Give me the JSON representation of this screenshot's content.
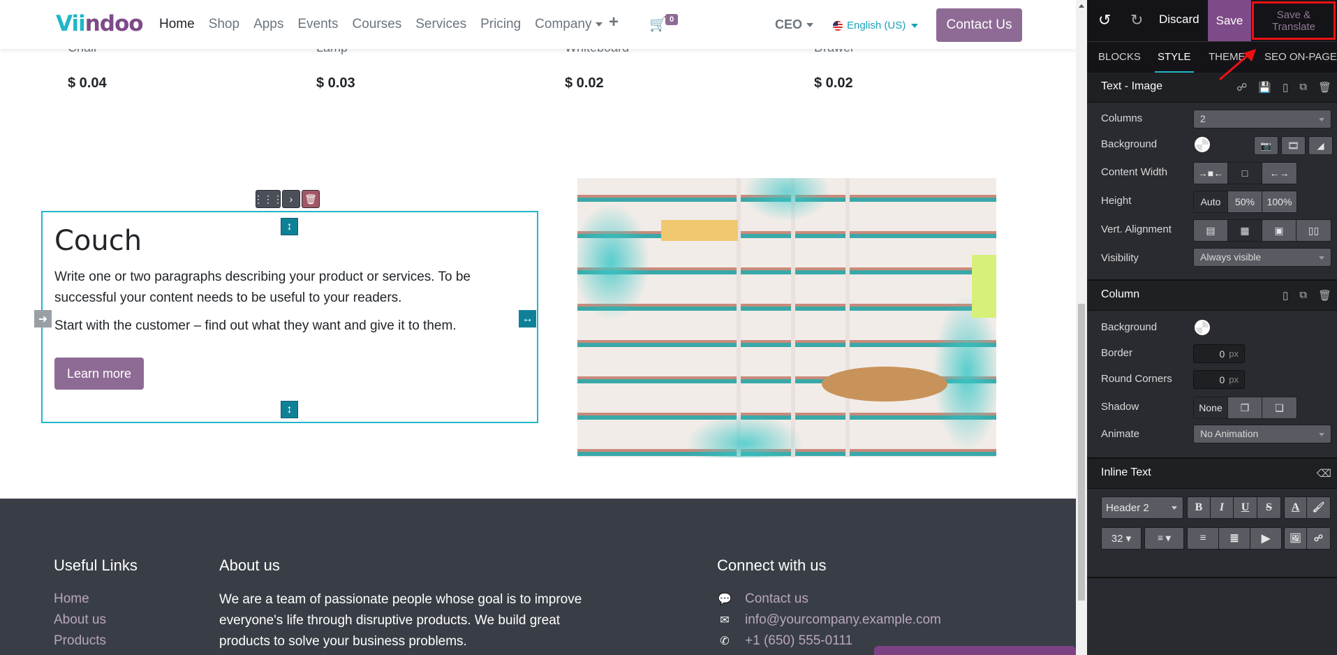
{
  "navbar": {
    "logo_part1": "Vii",
    "logo_part2": "ndoo",
    "menu": [
      "Home",
      "Shop",
      "Apps",
      "Events",
      "Courses",
      "Services",
      "Pricing",
      "Company"
    ],
    "active_item": "Home",
    "cart_count": "0",
    "user": "CEO",
    "language": "English (US)",
    "contact_button": "Contact Us"
  },
  "products": [
    {
      "name": "Chair",
      "price": "$ 0.04"
    },
    {
      "name": "Lamp",
      "price": "$ 0.03"
    },
    {
      "name": "Whiteboard",
      "price": "$ 0.02"
    },
    {
      "name": "Drawer",
      "price": "$ 0.02"
    }
  ],
  "snippet": {
    "title": "Couch",
    "paragraph1": "Write one or two paragraphs describing your product or services. To be successful your content needs to be useful to your readers.",
    "paragraph2": "Start with the customer – find out what they want and give it to them.",
    "button": "Learn more"
  },
  "footer": {
    "useful_links_title": "Useful Links",
    "useful_links": [
      "Home",
      "About us",
      "Products"
    ],
    "about_title": "About us",
    "about_text": "We are a team of passionate people whose goal is to improve everyone's life through disruptive products. We build great products to solve your business problems.",
    "connect_title": "Connect with us",
    "contacts": [
      {
        "icon": "comment-icon",
        "text": "Contact us"
      },
      {
        "icon": "envelope-icon",
        "text": "info@yourcompany.example.com"
      },
      {
        "icon": "phone-icon",
        "text": "+1 (650) 555-0111"
      }
    ]
  },
  "editor": {
    "discard": "Discard",
    "save": "Save",
    "save_translate_line1": "Save &",
    "save_translate_line2": "Translate",
    "tabs": [
      "BLOCKS",
      "STYLE",
      "THEME",
      "SEO ON-PAGE"
    ],
    "active_tab": "STYLE",
    "section_text_image": {
      "title": "Text - Image",
      "columns_label": "Columns",
      "columns_value": "2",
      "background_label": "Background",
      "content_width_label": "Content Width",
      "height_label": "Height",
      "height_options": [
        "Auto",
        "50%",
        "100%"
      ],
      "height_active": "Auto",
      "vert_alignment_label": "Vert. Alignment",
      "visibility_label": "Visibility",
      "visibility_value": "Always visible"
    },
    "section_column": {
      "title": "Column",
      "background_label": "Background",
      "border_label": "Border",
      "border_value": "0",
      "round_corners_label": "Round Corners",
      "round_corners_value": "0",
      "unit": "px",
      "shadow_label": "Shadow",
      "shadow_none": "None",
      "animate_label": "Animate",
      "animate_value": "No Animation"
    },
    "section_inline_text": {
      "title": "Inline Text",
      "style_value": "Header 2",
      "font_size_value": "32"
    }
  },
  "colors": {
    "brand_purple": "#8e6b95",
    "accent_teal": "#21b6c8",
    "footer_bg": "#393e46",
    "editor_bg": "#2a2b30",
    "highlight_red": "#ee1111"
  }
}
